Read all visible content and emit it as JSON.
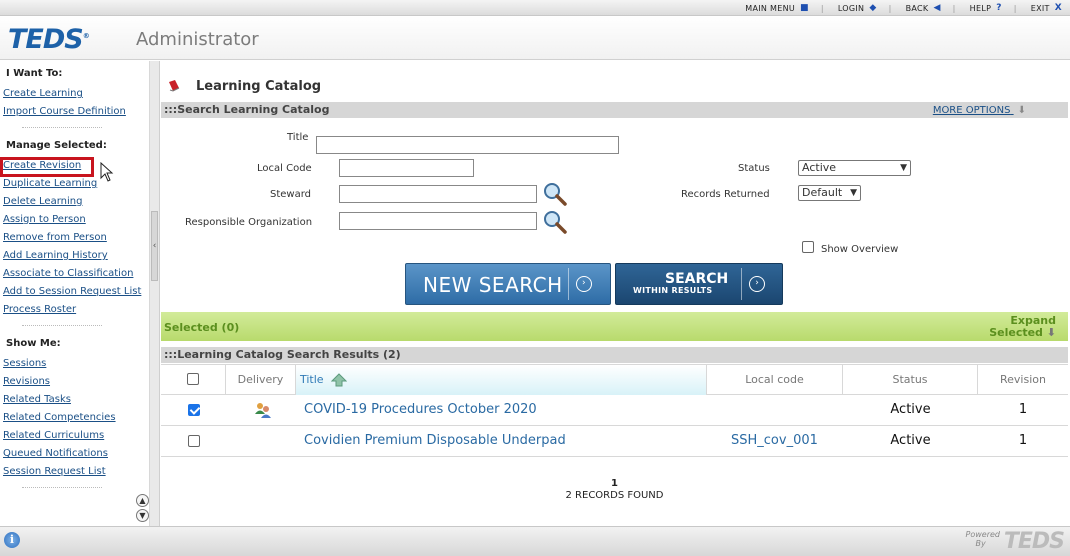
{
  "topnav": {
    "main_menu": "MAIN MENU",
    "login": "LOGIN",
    "back": "BACK",
    "help": "HELP",
    "exit": "EXIT"
  },
  "header": {
    "logo": "TEDS",
    "logo_mark": "®",
    "subtitle": "Administrator"
  },
  "sidebar": {
    "want_heading": "I Want To:",
    "want_items": [
      "Create Learning",
      "Import Course Definition"
    ],
    "manage_heading": "Manage Selected:",
    "manage_items": [
      "Create Revision",
      "Duplicate Learning",
      "Delete Learning",
      "Assign to Person",
      "Remove from Person",
      "Add Learning History",
      "Associate to Classification",
      "Add to Session Request List",
      "Process Roster"
    ],
    "show_heading": "Show Me:",
    "show_items": [
      "Sessions",
      "Revisions",
      "Related Tasks",
      "Related Competencies",
      "Related Curriculums",
      "Queued Notifications",
      "Session Request List"
    ]
  },
  "main": {
    "page_title": "Learning Catalog",
    "search_section": ":::Search Learning Catalog",
    "more_options": "MORE OPTIONS",
    "fields": {
      "title_label": "Title",
      "title_value": "",
      "local_code_label": "Local Code",
      "local_code_value": "",
      "steward_label": "Steward",
      "steward_value": "",
      "resp_org_label": "Responsible Organization",
      "resp_org_value": "",
      "status_label": "Status",
      "status_value": "Active",
      "records_label": "Records Returned",
      "records_value": "Default",
      "show_overview_label": "Show Overview"
    },
    "buttons": {
      "new_search": "NEW SEARCH",
      "search_within_l1": "SEARCH",
      "search_within_l2": "WITHIN RESULTS"
    },
    "selected_label": "Selected (0)",
    "expand_l1": "Expand",
    "expand_l2": "Selected",
    "results_section": ":::Learning Catalog Search Results (2)",
    "columns": {
      "delivery": "Delivery",
      "title": "Title",
      "local_code": "Local code",
      "status": "Status",
      "revision": "Revision"
    },
    "rows": [
      {
        "checked": true,
        "title": "COVID-19 Procedures October 2020",
        "local_code": "",
        "status": "Active",
        "revision": "1"
      },
      {
        "checked": false,
        "title": "Covidien Premium Disposable Underpad",
        "local_code": "SSH_cov_001",
        "status": "Active",
        "revision": "1"
      }
    ],
    "page_number": "1",
    "records_found": "2 RECORDS FOUND"
  },
  "footer": {
    "powered_l1": "Powered",
    "powered_l2": "By",
    "powered_logo": "TEDS"
  },
  "colors": {
    "brand_blue": "#1d61a8",
    "link_blue": "#1a4f86",
    "selected_green": "#5b8f1e",
    "highlight_red": "#c8141e"
  }
}
